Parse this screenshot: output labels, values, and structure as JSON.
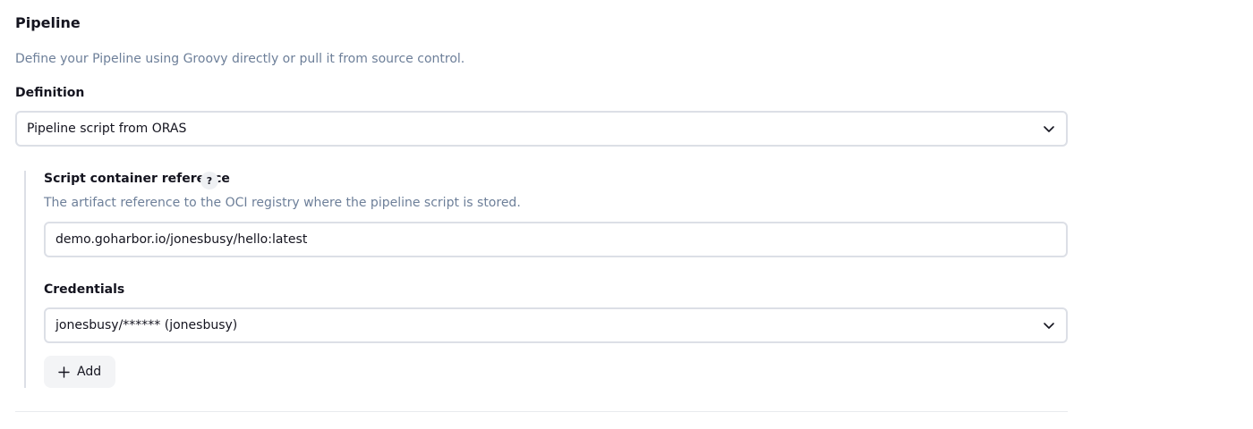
{
  "pipeline": {
    "title": "Pipeline",
    "description": "Define your Pipeline using Groovy directly or pull it from source control."
  },
  "definition": {
    "label": "Definition",
    "selected": "Pipeline script from ORAS",
    "icon": "chevron-down-icon"
  },
  "script_container": {
    "label": "Script container reference",
    "help_glyph": "?",
    "description": "The artifact reference to the OCI registry where the pipeline script is stored.",
    "value": "demo.goharbor.io/jonesbusy/hello:latest"
  },
  "credentials": {
    "label": "Credentials",
    "selected": "jonesbusy/****** (jonesbusy)",
    "icon": "chevron-down-icon",
    "add_label": "Add",
    "add_icon": "plus-icon"
  },
  "colors": {
    "muted_text": "#6d7f99",
    "border": "#dcdfe6",
    "button_bg": "#f3f4f6"
  }
}
